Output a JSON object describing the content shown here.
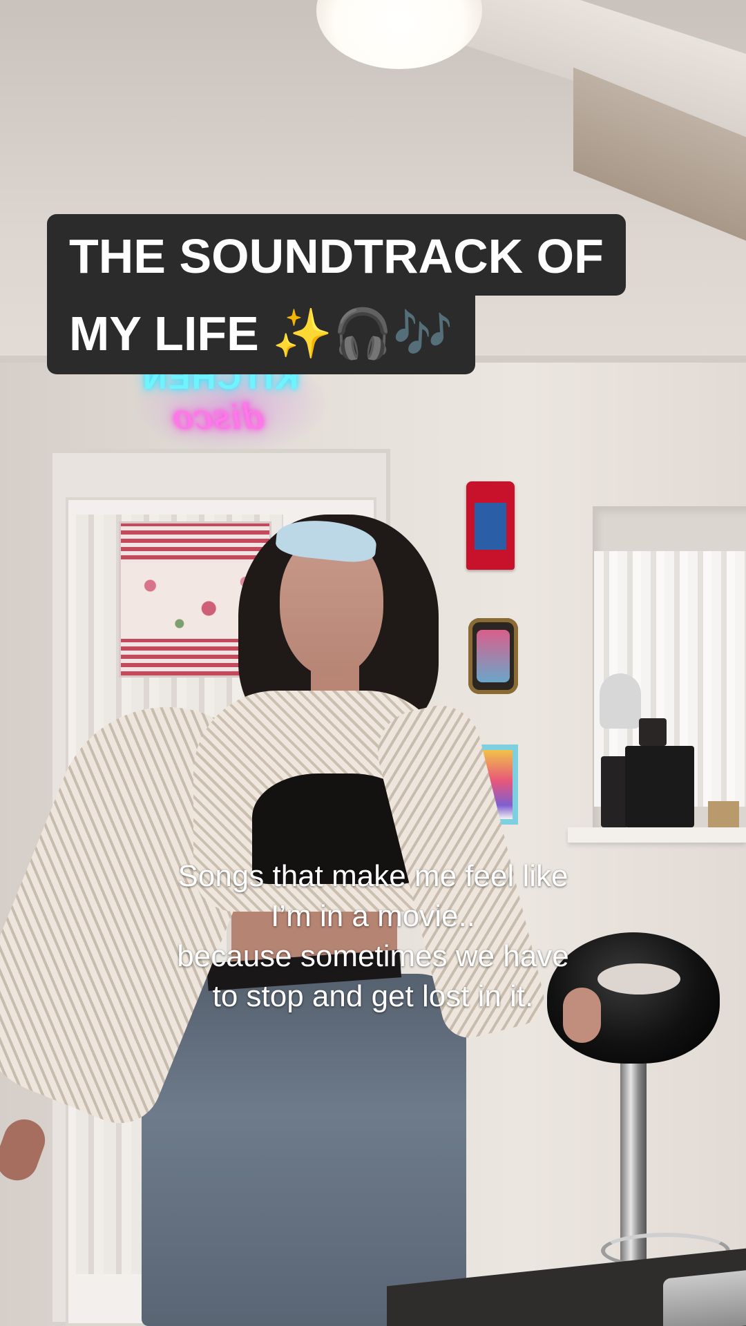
{
  "overlay": {
    "title_line1": "THE SOUNDTRACK OF",
    "title_line2": "MY LIFE ✨🎧🎶",
    "caption_lines": [
      "Songs that make me feel like",
      "I’m in a movie..",
      "because sometimes we have",
      "to stop and get lost in it."
    ]
  },
  "scene": {
    "neon_sign_line1": "KITCHEN",
    "neon_sign_line2": "disco",
    "colors": {
      "title_background": "#2b2b2b",
      "neon_cyan": "#6ff3ff",
      "neon_pink": "#ff77ea"
    }
  }
}
